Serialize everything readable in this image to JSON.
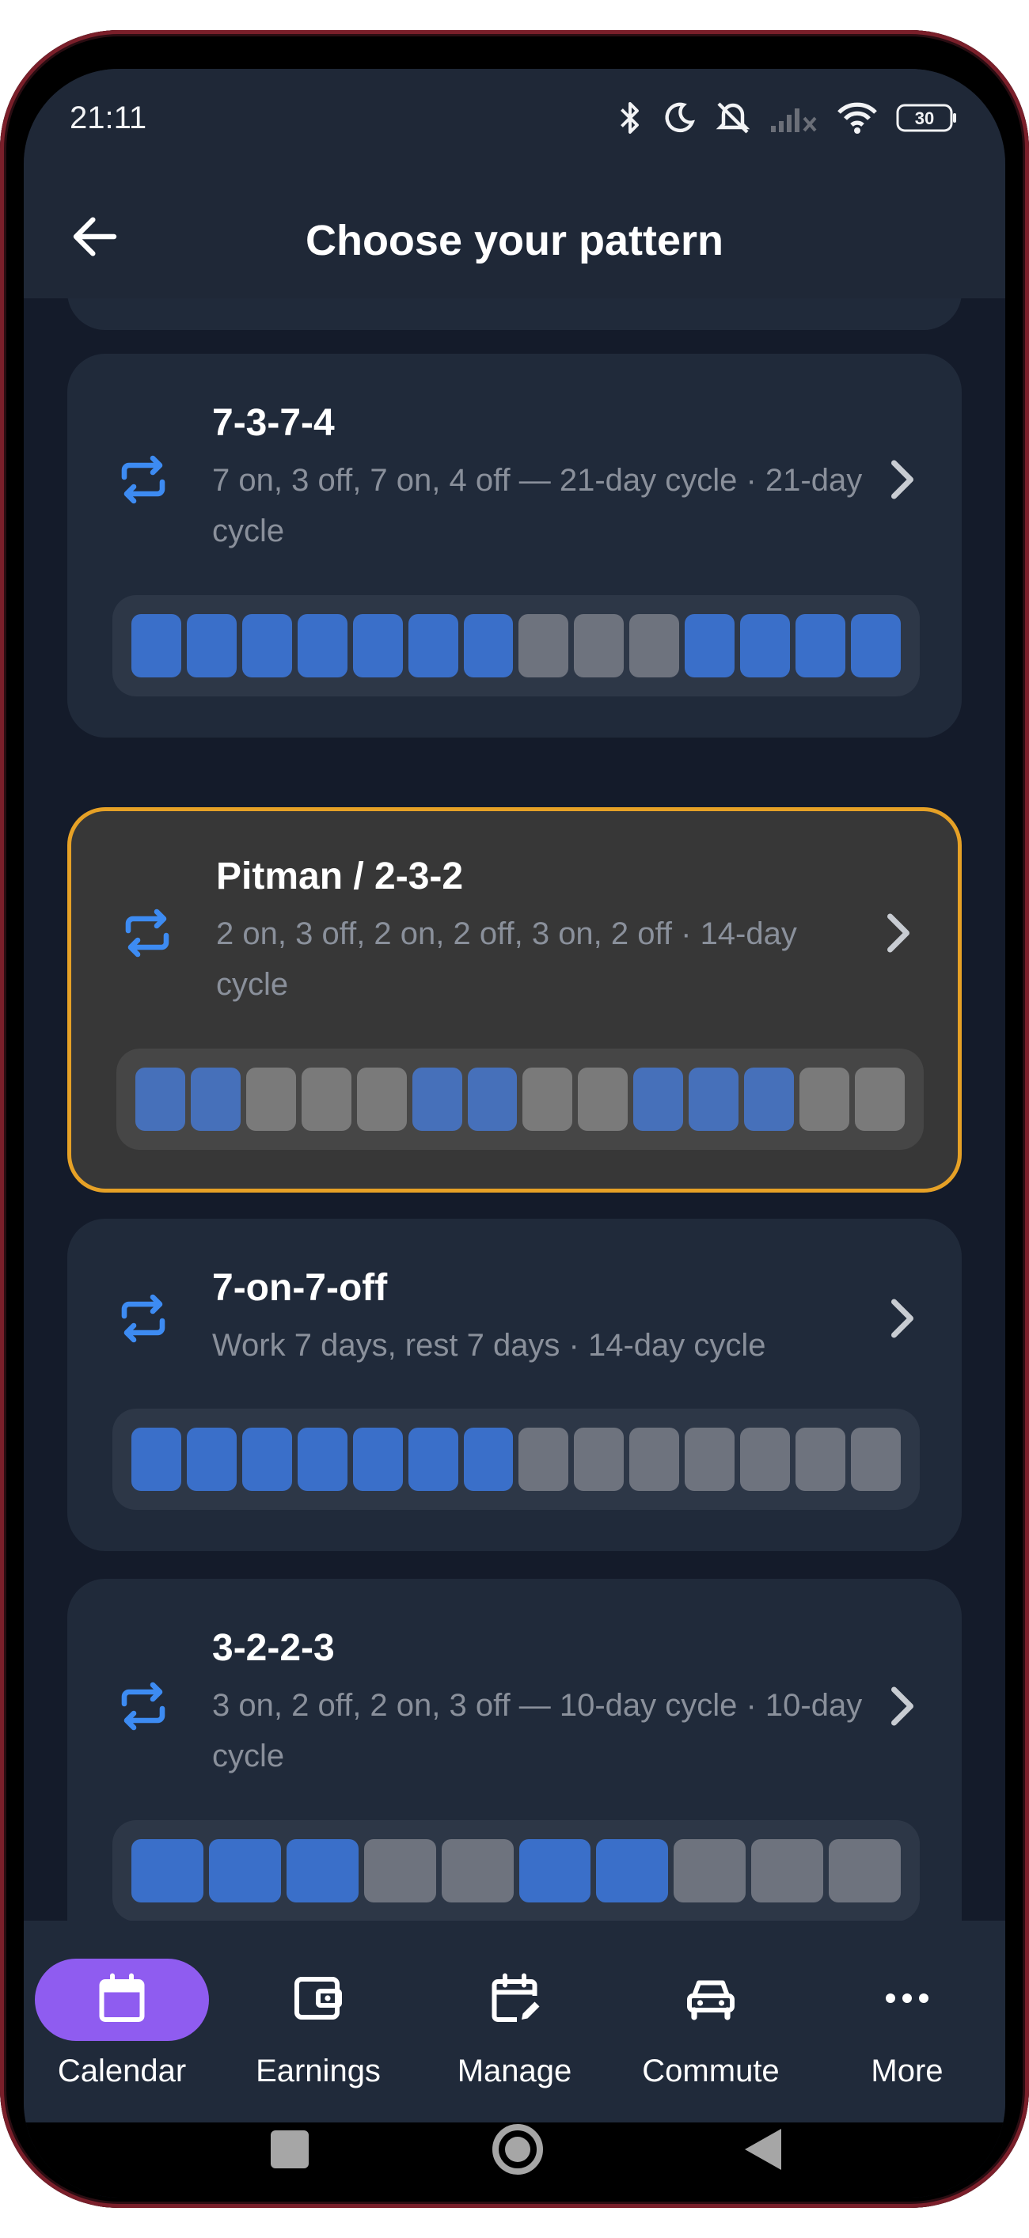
{
  "status_bar": {
    "time": "21:11",
    "battery": "30",
    "icons": [
      "bluetooth-icon",
      "moon-icon",
      "mute-icon",
      "signal-icon",
      "wifi-icon",
      "battery-icon"
    ]
  },
  "header": {
    "title": "Choose your pattern",
    "back_icon": "arrow-left-icon"
  },
  "patterns": [
    {
      "name": "7-3-7-4",
      "subtitle": "7 on, 3 off, 7 on, 4 off — 21-day cycle · 21-day cycle",
      "days": [
        1,
        1,
        1,
        1,
        1,
        1,
        1,
        0,
        0,
        0,
        1,
        1,
        1,
        1
      ],
      "selected": false
    },
    {
      "name": "Pitman / 2-3-2",
      "subtitle": "2 on, 3 off, 2 on, 2 off, 3 on, 2 off · 14-day cycle",
      "days": [
        1,
        1,
        0,
        0,
        0,
        1,
        1,
        0,
        0,
        1,
        1,
        1,
        0,
        0
      ],
      "selected": true
    },
    {
      "name": "7-on-7-off",
      "subtitle": "Work 7 days, rest 7 days · 14-day cycle",
      "days": [
        1,
        1,
        1,
        1,
        1,
        1,
        1,
        0,
        0,
        0,
        0,
        0,
        0,
        0
      ],
      "selected": false
    },
    {
      "name": "3-2-2-3",
      "subtitle": "3 on, 2 off, 2 on, 3 off — 10-day cycle · 10-day cycle",
      "days": [
        1,
        1,
        1,
        0,
        0,
        1,
        1,
        0,
        0,
        0
      ],
      "selected": false
    }
  ],
  "nav": {
    "items": [
      {
        "label": "Calendar",
        "icon": "calendar-icon",
        "active": true
      },
      {
        "label": "Earnings",
        "icon": "wallet-icon",
        "active": false
      },
      {
        "label": "Manage",
        "icon": "calendar-edit-icon",
        "active": false
      },
      {
        "label": "Commute",
        "icon": "car-icon",
        "active": false
      },
      {
        "label": "More",
        "icon": "more-horizontal-icon",
        "active": false
      }
    ]
  },
  "colors": {
    "background": "#141b2a",
    "card": "#202a3a",
    "selected_card": "#373737",
    "selected_border": "#e6a126",
    "on_day": "#3a6fc9",
    "off_day": "#6e737e",
    "accent": "#3d8bf2",
    "nav_active": "#8f5cf0"
  }
}
